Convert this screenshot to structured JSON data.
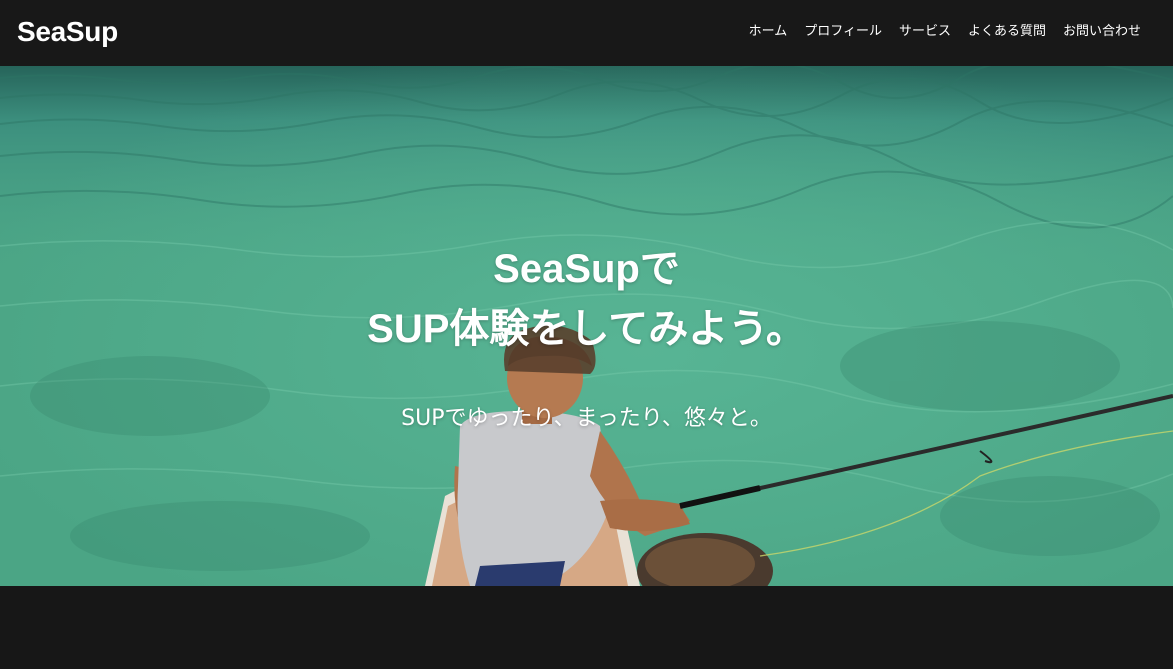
{
  "header": {
    "logo": "SeaSup",
    "nav": [
      {
        "label": "ホーム"
      },
      {
        "label": "プロフィール"
      },
      {
        "label": "サービス"
      },
      {
        "label": "よくある質問"
      },
      {
        "label": "お問い合わせ"
      }
    ]
  },
  "hero": {
    "title_line1": "SeaSupで",
    "title_line2": "SUP体験をしてみよう。",
    "subtitle": "SUPでゆったり、まったり、悠々と。",
    "image": "hero-photo-sup-fishing"
  },
  "colors": {
    "header_bg": "#181818",
    "water": "#4faa8a",
    "text": "#ffffff"
  }
}
